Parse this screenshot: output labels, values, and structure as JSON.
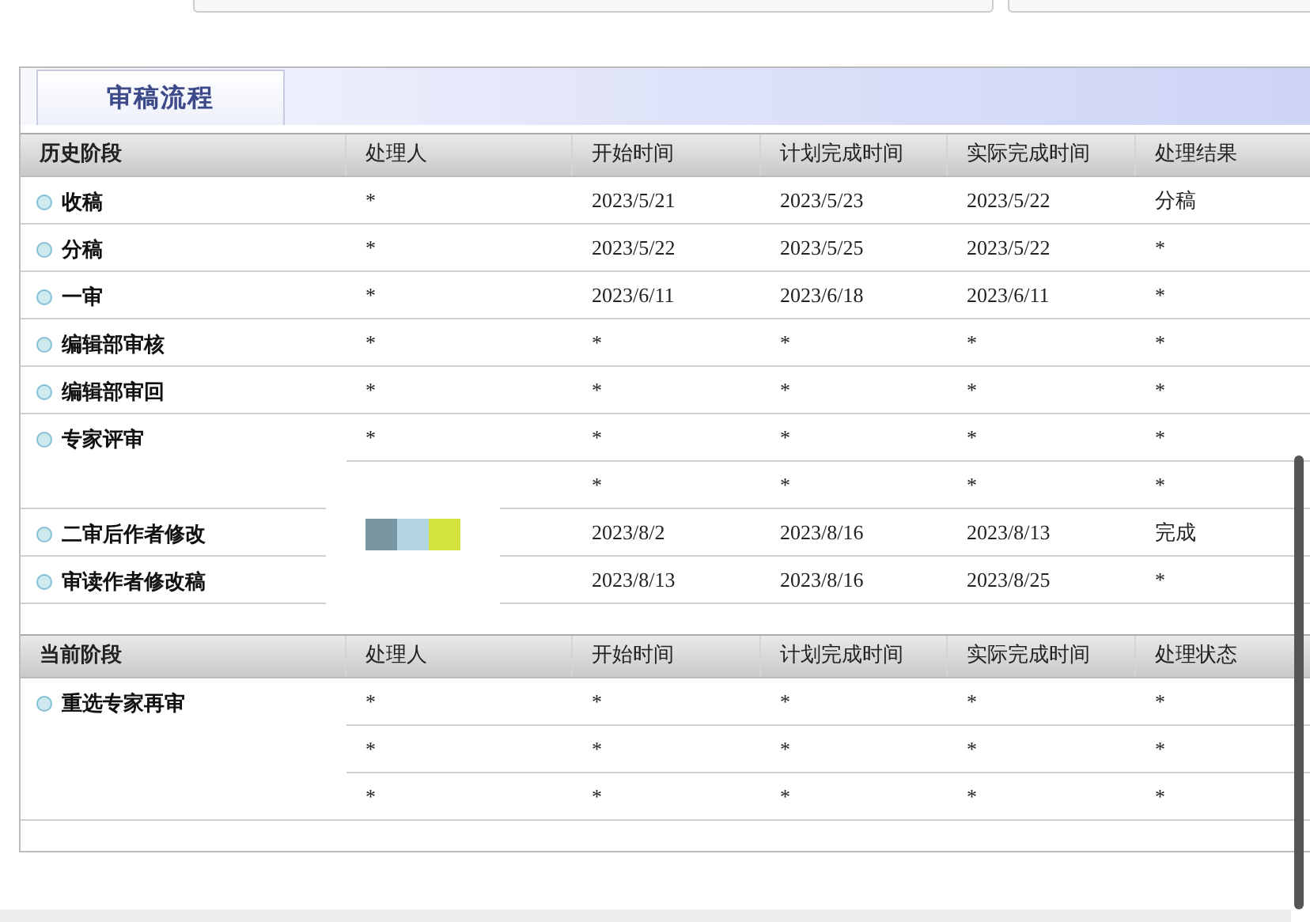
{
  "tab": {
    "label": "审稿流程",
    "selected": true
  },
  "history": {
    "columns": [
      "历史阶段",
      "处理人",
      "开始时间",
      "计划完成时间",
      "实际完成时间",
      "处理结果"
    ],
    "stages": [
      {
        "name": "收稿",
        "rows": [
          [
            "*",
            "2023/5/21",
            "2023/5/23",
            "2023/5/22",
            "分稿"
          ]
        ]
      },
      {
        "name": "分稿",
        "rows": [
          [
            "*",
            "2023/5/22",
            "2023/5/25",
            "2023/5/22",
            "*"
          ]
        ]
      },
      {
        "name": "一审",
        "rows": [
          [
            "*",
            "2023/6/11",
            "2023/6/18",
            "2023/6/11",
            "*"
          ]
        ]
      },
      {
        "name": "编辑部审核",
        "rows": [
          [
            "*",
            "*",
            "*",
            "*",
            "*"
          ]
        ]
      },
      {
        "name": "编辑部审回",
        "rows": [
          [
            "*",
            "*",
            "*",
            "*",
            "*"
          ]
        ]
      },
      {
        "name": "专家评审",
        "rows": [
          [
            "*",
            "*",
            "*",
            "*",
            "*"
          ],
          [
            null,
            "*",
            "*",
            "*",
            "*"
          ]
        ]
      },
      {
        "name": "二审后作者修改",
        "rows": [
          [
            null,
            "2023/8/2",
            "2023/8/16",
            "2023/8/13",
            "完成"
          ]
        ]
      },
      {
        "name": "审读作者修改稿",
        "rows": [
          [
            null,
            "2023/8/13",
            "2023/8/16",
            "2023/8/25",
            "*"
          ]
        ]
      }
    ]
  },
  "current": {
    "columns": [
      "当前阶段",
      "处理人",
      "开始时间",
      "计划完成时间",
      "实际完成时间",
      "处理状态"
    ],
    "stages": [
      {
        "name": "重选专家再审",
        "rows": [
          [
            "*",
            "*",
            "*",
            "*",
            "*"
          ],
          [
            "*",
            "*",
            "*",
            "*",
            "*"
          ],
          [
            "*",
            "*",
            "*",
            "*",
            "*"
          ]
        ]
      }
    ]
  }
}
